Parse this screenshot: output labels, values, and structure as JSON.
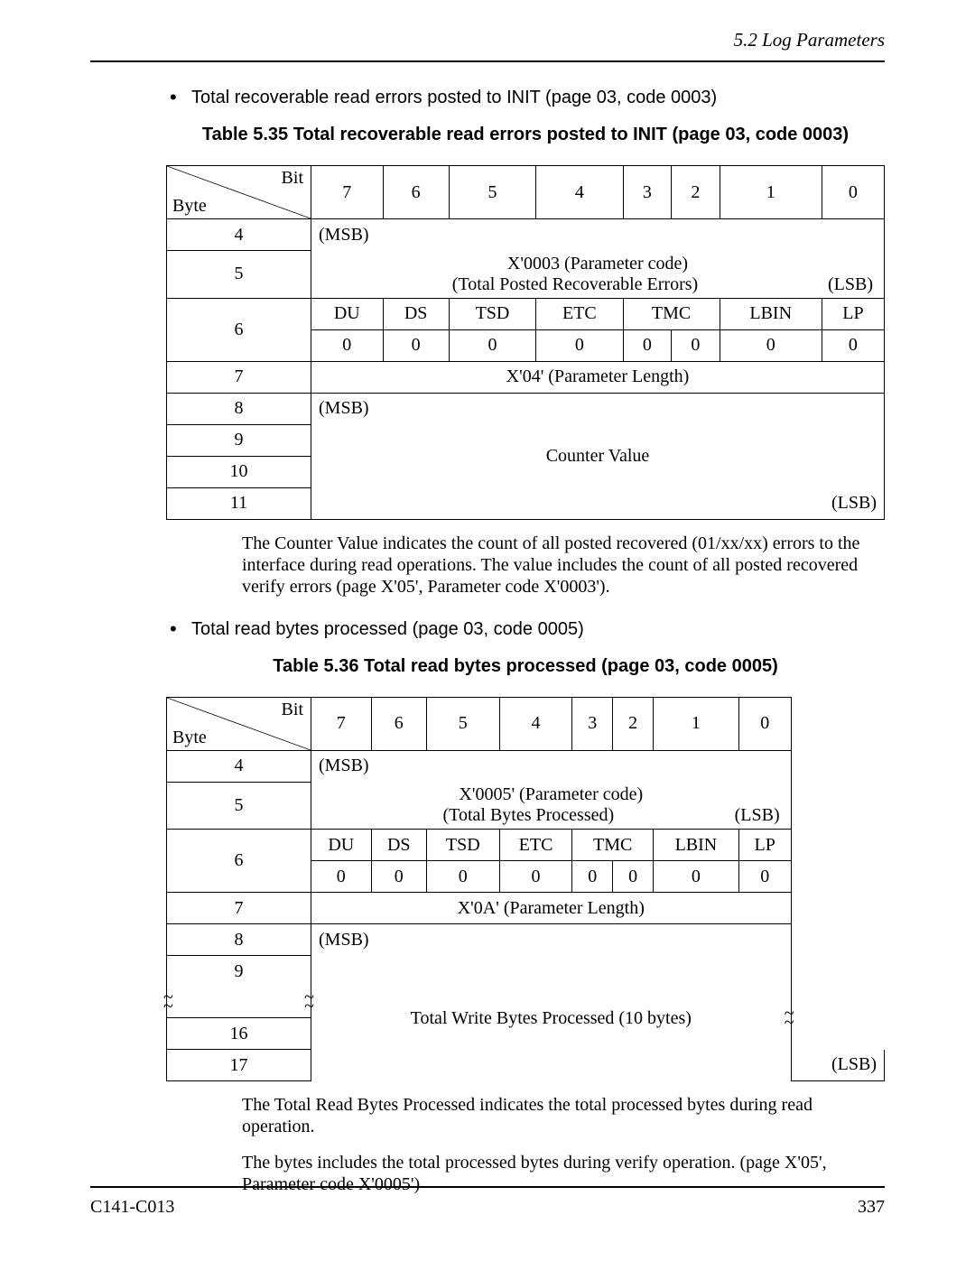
{
  "header_section": "5.2  Log Parameters",
  "bullet1": "Total recoverable read errors posted to INIT (page 03, code 0003)",
  "caption1": "Table 5.35  Total recoverable read errors posted to INIT (page 03, code 0003)",
  "hdr": {
    "bit": "Bit",
    "byte": "Byte",
    "b7": "7",
    "b6": "6",
    "b5": "5",
    "b4": "4",
    "b3": "3",
    "b2": "2",
    "b1": "1",
    "b0": "0"
  },
  "t1": {
    "r4": "4",
    "msb": "(MSB)",
    "r5": "5",
    "pcode": "X'0003 (Parameter code)",
    "psub": "(Total Posted Recoverable Errors)",
    "lsb": "(LSB)",
    "r6": "6",
    "du": "DU",
    "ds": "DS",
    "tsd": "TSD",
    "etc": "ETC",
    "tmc": "TMC",
    "lbin": "LBIN",
    "lp": "LP",
    "z": "0",
    "r7": "7",
    "plen": "X'04' (Parameter Length)",
    "r8": "8",
    "r9": "9",
    "r10": "10",
    "r11": "11",
    "cval": "Counter Value"
  },
  "para1": "The Counter Value indicates the count of all posted recovered (01/xx/xx) errors to the interface during read operations.  The value includes the count of all posted recovered verify errors (page X'05', Parameter code X'0003').",
  "bullet2": "Total read bytes processed (page 03, code 0005)",
  "caption2": "Table 5.36  Total read bytes processed (page 03, code 0005)",
  "t2": {
    "r4": "4",
    "msb": "(MSB)",
    "r5": "5",
    "pcode": "X'0005' (Parameter code)",
    "psub": "(Total Bytes Processed)",
    "lsb": "(LSB)",
    "r6": "6",
    "du": "DU",
    "ds": "DS",
    "tsd": "TSD",
    "etc": "ETC",
    "tmc": "TMC",
    "lbin": "LBIN",
    "lp": "LP",
    "z": "0",
    "r7": "7",
    "plen": "X'0A' (Parameter Length)",
    "r8": "8",
    "r9": "9",
    "r16": "16",
    "r17": "17",
    "mid": "Total Write Bytes Processed (10 bytes)"
  },
  "para2": "The Total Read Bytes Processed indicates the total processed bytes during read operation.",
  "para3": "The bytes includes the total processed bytes during verify operation.  (page X'05', Parameter code X'0005')",
  "footer_left": "C141-C013",
  "footer_right": "337"
}
